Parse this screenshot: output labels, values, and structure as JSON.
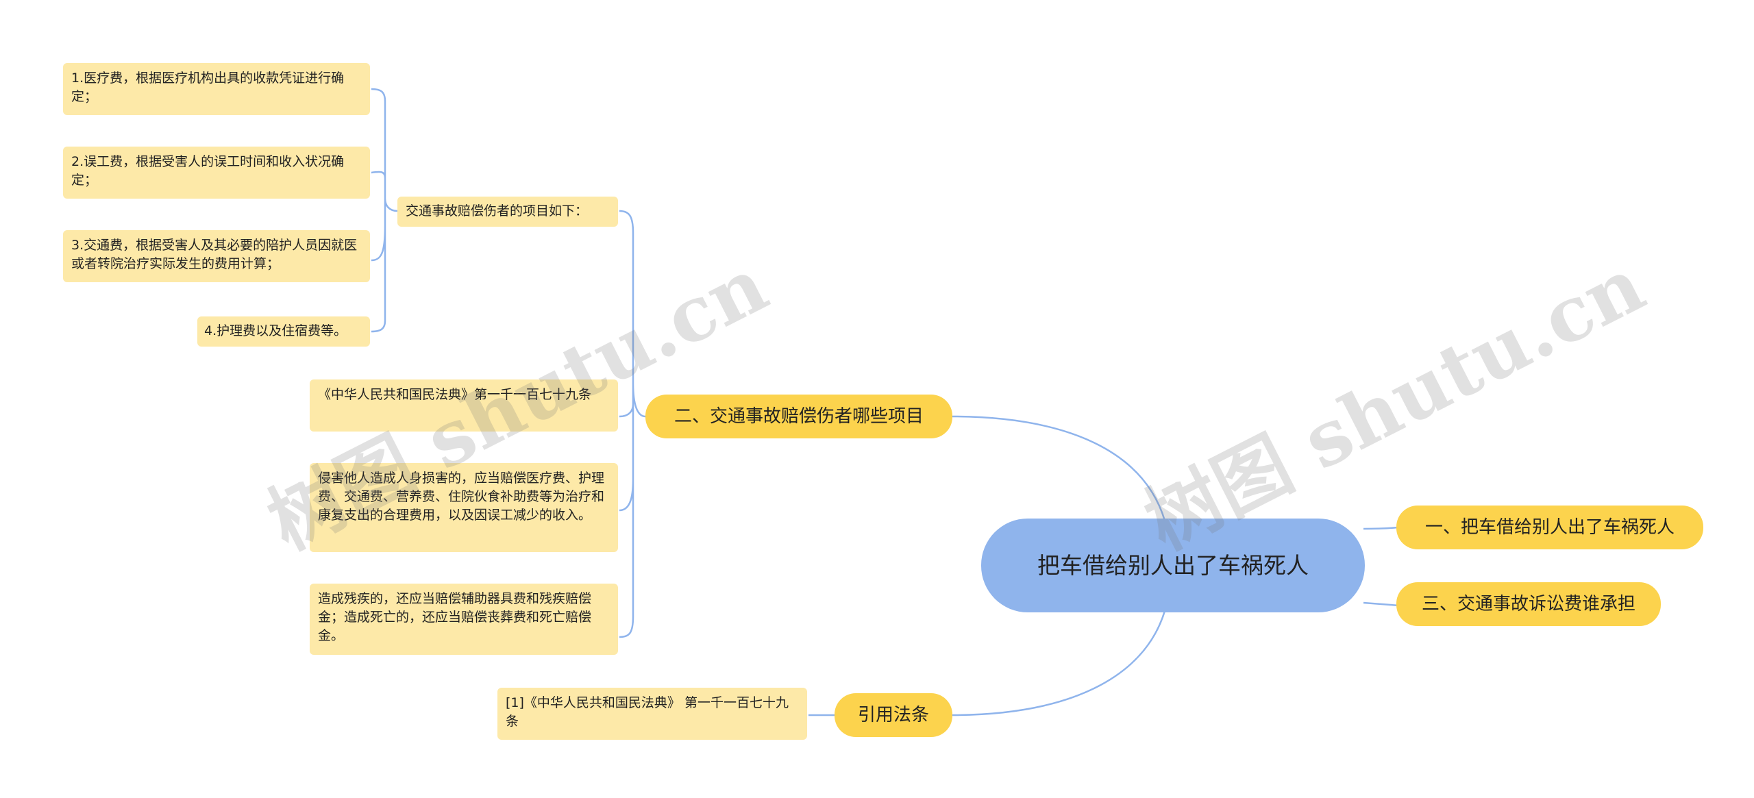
{
  "root": {
    "label": "把车借给别人出了车祸死人"
  },
  "branches": {
    "b1": "一、把车借给别人出了车祸死人",
    "b2": "二、交通事故赔偿伤者哪些项目",
    "b3": "三、交通事故诉讼费谁承担",
    "b4": "引用法条"
  },
  "b2_children": {
    "items_heading": "交通事故赔偿伤者的项目如下：",
    "items": [
      "1.医疗费，根据医疗机构出具的收款凭证进行确定；",
      "2.误工费，根据受害人的误工时间和收入状况确定；",
      "3.交通费，根据受害人及其必要的陪护人员因就医或者转院治疗实际发生的费用计算；",
      "4.护理费以及住宿费等。"
    ],
    "law_title": "《中华人民共和国民法典》第一千一百七十九条",
    "law_text_1": "侵害他人造成人身损害的，应当赔偿医疗费、护理费、交通费、营养费、住院伙食补助费等为治疗和康复支出的合理费用，以及因误工减少的收入。",
    "law_text_2": "造成残疾的，还应当赔偿辅助器具费和残疾赔偿金；造成死亡的，还应当赔偿丧葬费和死亡赔偿金。"
  },
  "b4_children": {
    "citation": "[1]《中华人民共和国民法典》 第一千一百七十九条"
  },
  "watermarks": [
    "树图 shutu.cn",
    "树图 shutu.cn"
  ],
  "colors": {
    "root_fill": "#8fb4ec",
    "branch_fill": "#fcd34d",
    "leaf_fill": "#fde9a8",
    "connector": "#8fb4ec"
  }
}
